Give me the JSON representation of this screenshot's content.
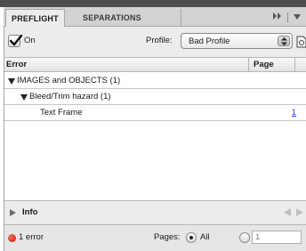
{
  "tabs": [
    {
      "label": "PREFLIGHT",
      "active": true
    },
    {
      "label": "SEPARATIONS PREVIEW",
      "active": false
    }
  ],
  "panel_menu_icon": "double-chevron-right-icon",
  "controls": {
    "on_checkbox": {
      "label": "On",
      "checked": true
    },
    "profile_label": "Profile:",
    "profile_value": "Bad Profile"
  },
  "table": {
    "columns": [
      "Error",
      "Page"
    ],
    "rows": [
      {
        "label": "IMAGES and OBJECTS (1)",
        "level": 0,
        "expanded": true,
        "page": ""
      },
      {
        "label": "Bleed/Trim hazard (1)",
        "level": 1,
        "expanded": true,
        "page": ""
      },
      {
        "label": "Text Frame",
        "level": 2,
        "expanded": false,
        "page": "1"
      }
    ]
  },
  "info": {
    "label": "Info",
    "expanded": false
  },
  "status": {
    "error_text": "1 error",
    "pages_label": "Pages:",
    "all_label": "All",
    "range_value": "1",
    "selected": "All"
  },
  "colors": {
    "error_dot": "#d9261c",
    "link": "#1a3fd6"
  }
}
